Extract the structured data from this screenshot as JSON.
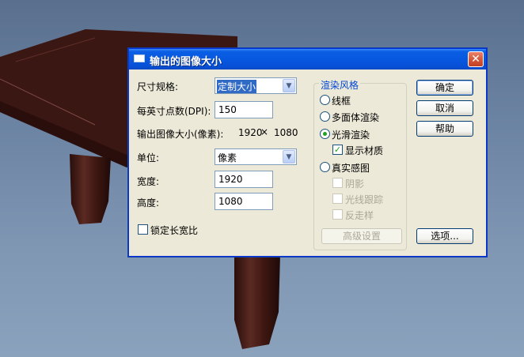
{
  "dialog": {
    "title": "输出的图像大小",
    "close_glyph": "✕"
  },
  "form": {
    "size_spec_label": "尺寸规格:",
    "size_spec_value": "定制大小",
    "dpi_label": "每英寸点数(DPI):",
    "dpi_value": "150",
    "output_size_label": "输出图像大小(像素):",
    "output_width": "1920",
    "output_times": "×",
    "output_height": "1080",
    "unit_label": "单位:",
    "unit_value": "像素",
    "width_label": "宽度:",
    "width_value": "1920",
    "height_label": "高度:",
    "height_value": "1080",
    "lock_ratio_label": "锁定长宽比",
    "lock_ratio_checked": false
  },
  "render_style": {
    "group_title": "渲染风格",
    "options": [
      {
        "label": "线框",
        "selected": false
      },
      {
        "label": "多面体渲染",
        "selected": false
      },
      {
        "label": "光滑渲染",
        "selected": true
      },
      {
        "label": "真实感图",
        "selected": false
      }
    ],
    "show_material_label": "显示材质",
    "show_material_checked": true,
    "realistic_sub": [
      {
        "label": "阴影",
        "checked": false
      },
      {
        "label": "光线跟踪",
        "checked": false
      },
      {
        "label": "反走样",
        "checked": false
      }
    ],
    "advanced_button": "高级设置"
  },
  "buttons": {
    "ok": "确定",
    "cancel": "取消",
    "help": "帮助",
    "options": "选项..."
  },
  "colors": {
    "title_bar": "#0758e0",
    "dialog_bg": "#ece9d8",
    "table_wood": "#3a1612",
    "selection": "#316ac5",
    "group_title": "#0046d5"
  }
}
